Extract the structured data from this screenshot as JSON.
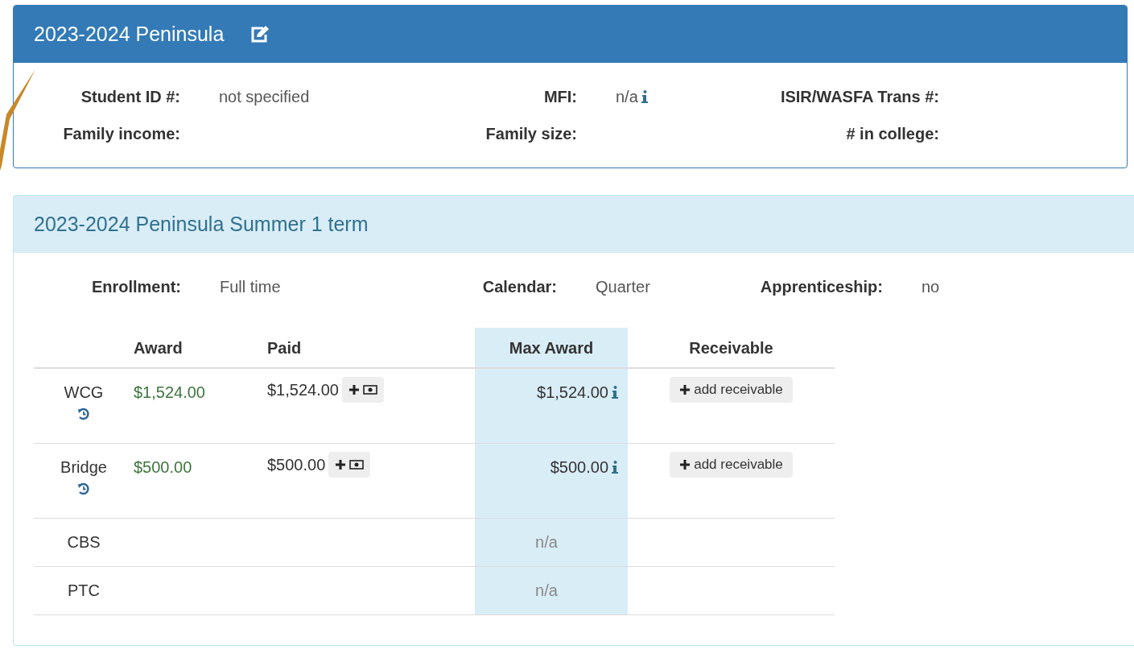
{
  "aid_year": {
    "title": "2023-2024 Peninsula",
    "fields": [
      {
        "label": "Student ID #:",
        "value": "not specified"
      },
      {
        "label": "MFI:",
        "value": "n/a",
        "info": true
      },
      {
        "label": "ISIR/WASFA Trans #:"
      },
      {
        "label": "Family income:"
      },
      {
        "label": "Family size:"
      },
      {
        "label": "# in college:"
      }
    ]
  },
  "term": {
    "title": "2023-2024 Peninsula Summer 1 term",
    "fields": [
      {
        "label": "Enrollment:",
        "value": "Full time"
      },
      {
        "label": "Calendar:",
        "value": "Quarter"
      },
      {
        "label": "Apprenticeship:",
        "value": "no"
      }
    ],
    "table": {
      "columns": [
        "Award",
        "Paid",
        "Max Award",
        "Receivable"
      ],
      "rows": [
        {
          "name": "WCG",
          "history": true,
          "award": "$1,524.00",
          "paid": "$1,524.00",
          "add_payment": true,
          "max_award": "$1,524.00",
          "info": true,
          "receivable_button": "add receivable"
        },
        {
          "name": "Bridge",
          "history": true,
          "award": "$500.00",
          "paid": "$500.00",
          "add_payment": true,
          "max_award": "$500.00",
          "info": true,
          "receivable_button": "add receivable"
        },
        {
          "name": "CBS",
          "history": false,
          "max_award": "n/a",
          "info": false
        },
        {
          "name": "PTC",
          "history": false,
          "max_award": "n/a",
          "info": false
        }
      ]
    }
  }
}
